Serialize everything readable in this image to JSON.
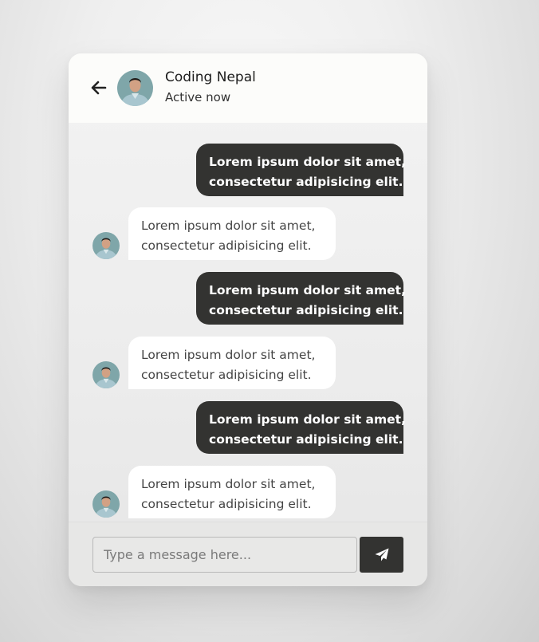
{
  "header": {
    "name": "Coding Nepal",
    "status": "Active now",
    "back_icon": "arrow-left-icon"
  },
  "messages": [
    {
      "direction": "outgoing",
      "line1": "Lorem ipsum dolor sit amet,",
      "line2": "consectetur adipisicing elit."
    },
    {
      "direction": "incoming",
      "line1": "Lorem ipsum dolor sit amet,",
      "line2": "consectetur adipisicing elit."
    },
    {
      "direction": "outgoing",
      "line1": "Lorem ipsum dolor sit amet,",
      "line2": "consectetur adipisicing elit."
    },
    {
      "direction": "incoming",
      "line1": "Lorem ipsum dolor sit amet,",
      "line2": "consectetur adipisicing elit."
    },
    {
      "direction": "outgoing",
      "line1": "Lorem ipsum dolor sit amet,",
      "line2": "consectetur adipisicing elit."
    },
    {
      "direction": "incoming",
      "line1": "Lorem ipsum dolor sit amet,",
      "line2": "consectetur adipisicing elit."
    }
  ],
  "composer": {
    "placeholder": "Type a message here...",
    "value": "",
    "send_icon": "paper-plane-icon"
  },
  "colors": {
    "dark_bubble": "#333331",
    "light_bubble": "#ffffff",
    "header_bg": "#fcfcfa"
  }
}
